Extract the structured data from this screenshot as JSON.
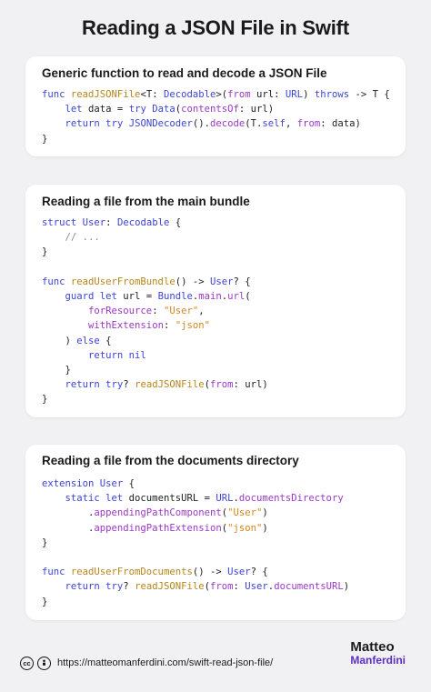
{
  "page": {
    "title": "Reading a JSON File in Swift"
  },
  "cards": [
    {
      "title": "Generic function to read and decode a JSON File",
      "lines": [
        [
          [
            "kw",
            "func "
          ],
          [
            "fn",
            "readJSONFile"
          ],
          [
            "pl",
            "<T: "
          ],
          [
            "ty",
            "Decodable"
          ],
          [
            "pl",
            ">("
          ],
          [
            "pr",
            "from"
          ],
          [
            "pl",
            " url: "
          ],
          [
            "ty",
            "URL"
          ],
          [
            "pl",
            ") "
          ],
          [
            "kw",
            "throws"
          ],
          [
            "pl",
            " -> T {"
          ]
        ],
        [
          [
            "pl",
            "    "
          ],
          [
            "kw",
            "let"
          ],
          [
            "pl",
            " data = "
          ],
          [
            "kw",
            "try "
          ],
          [
            "ty",
            "Data"
          ],
          [
            "pl",
            "("
          ],
          [
            "pr",
            "contentsOf"
          ],
          [
            "pl",
            ": url)"
          ]
        ],
        [
          [
            "pl",
            "    "
          ],
          [
            "kw",
            "return try "
          ],
          [
            "ty",
            "JSONDecoder"
          ],
          [
            "pl",
            "()."
          ],
          [
            "pr",
            "decode"
          ],
          [
            "pl",
            "(T."
          ],
          [
            "kw",
            "self"
          ],
          [
            "pl",
            ", "
          ],
          [
            "pr",
            "from"
          ],
          [
            "pl",
            ": data)"
          ]
        ],
        [
          [
            "pl",
            "}"
          ]
        ]
      ]
    },
    {
      "title": "Reading a file from the main bundle",
      "lines": [
        [
          [
            "kw",
            "struct "
          ],
          [
            "ty",
            "User"
          ],
          [
            "pl",
            ": "
          ],
          [
            "ty",
            "Decodable"
          ],
          [
            "pl",
            " {"
          ]
        ],
        [
          [
            "cm",
            "    // ..."
          ]
        ],
        [
          [
            "pl",
            "}"
          ]
        ],
        [
          [
            "pl",
            ""
          ]
        ],
        [
          [
            "kw",
            "func "
          ],
          [
            "fn",
            "readUserFromBundle"
          ],
          [
            "pl",
            "() -> "
          ],
          [
            "ty",
            "User"
          ],
          [
            "pl",
            "? {"
          ]
        ],
        [
          [
            "pl",
            "    "
          ],
          [
            "kw",
            "guard let"
          ],
          [
            "pl",
            " url = "
          ],
          [
            "ty",
            "Bundle"
          ],
          [
            "pl",
            "."
          ],
          [
            "pr",
            "main"
          ],
          [
            "pl",
            "."
          ],
          [
            "pr",
            "url"
          ],
          [
            "pl",
            "("
          ]
        ],
        [
          [
            "pl",
            "        "
          ],
          [
            "pr",
            "forResource"
          ],
          [
            "pl",
            ": "
          ],
          [
            "st",
            "\"User\""
          ],
          [
            "pl",
            ","
          ]
        ],
        [
          [
            "pl",
            "        "
          ],
          [
            "pr",
            "withExtension"
          ],
          [
            "pl",
            ": "
          ],
          [
            "st",
            "\"json\""
          ]
        ],
        [
          [
            "pl",
            "    ) "
          ],
          [
            "kw",
            "else"
          ],
          [
            "pl",
            " {"
          ]
        ],
        [
          [
            "pl",
            "        "
          ],
          [
            "kw",
            "return nil"
          ]
        ],
        [
          [
            "pl",
            "    }"
          ]
        ],
        [
          [
            "pl",
            "    "
          ],
          [
            "kw",
            "return try"
          ],
          [
            "pl",
            "? "
          ],
          [
            "fn",
            "readJSONFile"
          ],
          [
            "pl",
            "("
          ],
          [
            "pr",
            "from"
          ],
          [
            "pl",
            ": url)"
          ]
        ],
        [
          [
            "pl",
            "}"
          ]
        ]
      ]
    },
    {
      "title": "Reading a file from the documents directory",
      "lines": [
        [
          [
            "kw",
            "extension "
          ],
          [
            "ty",
            "User"
          ],
          [
            "pl",
            " {"
          ]
        ],
        [
          [
            "pl",
            "    "
          ],
          [
            "kw",
            "static let"
          ],
          [
            "pl",
            " documentsURL = "
          ],
          [
            "ty",
            "URL"
          ],
          [
            "pl",
            "."
          ],
          [
            "pr",
            "documentsDirectory"
          ]
        ],
        [
          [
            "pl",
            "        ."
          ],
          [
            "pr",
            "appendingPathComponent"
          ],
          [
            "pl",
            "("
          ],
          [
            "st",
            "\"User\""
          ],
          [
            "pl",
            ")"
          ]
        ],
        [
          [
            "pl",
            "        ."
          ],
          [
            "pr",
            "appendingPathExtension"
          ],
          [
            "pl",
            "("
          ],
          [
            "st",
            "\"json\""
          ],
          [
            "pl",
            ")"
          ]
        ],
        [
          [
            "pl",
            "}"
          ]
        ],
        [
          [
            "pl",
            ""
          ]
        ],
        [
          [
            "kw",
            "func "
          ],
          [
            "fn",
            "readUserFromDocuments"
          ],
          [
            "pl",
            "() -> "
          ],
          [
            "ty",
            "User"
          ],
          [
            "pl",
            "? {"
          ]
        ],
        [
          [
            "pl",
            "    "
          ],
          [
            "kw",
            "return try"
          ],
          [
            "pl",
            "? "
          ],
          [
            "fn",
            "readJSONFile"
          ],
          [
            "pl",
            "("
          ],
          [
            "pr",
            "from"
          ],
          [
            "pl",
            ": "
          ],
          [
            "ty",
            "User"
          ],
          [
            "pl",
            "."
          ],
          [
            "pr",
            "documentsURL"
          ],
          [
            "pl",
            ")"
          ]
        ],
        [
          [
            "pl",
            "}"
          ]
        ]
      ]
    }
  ],
  "footer": {
    "cc_icon": "cc",
    "by_icon": "attribution-person",
    "url": "https://matteomanferdini.com/swift-read-json-file/",
    "brand_first": "Matteo",
    "brand_last": "Manferdini"
  },
  "colors": {
    "keyword": "#3d44d6",
    "function": "#b6861b",
    "property": "#9b38c8",
    "string": "#d6871c",
    "comment": "#8a8a8a",
    "brand_accent": "#5b2fc4"
  }
}
